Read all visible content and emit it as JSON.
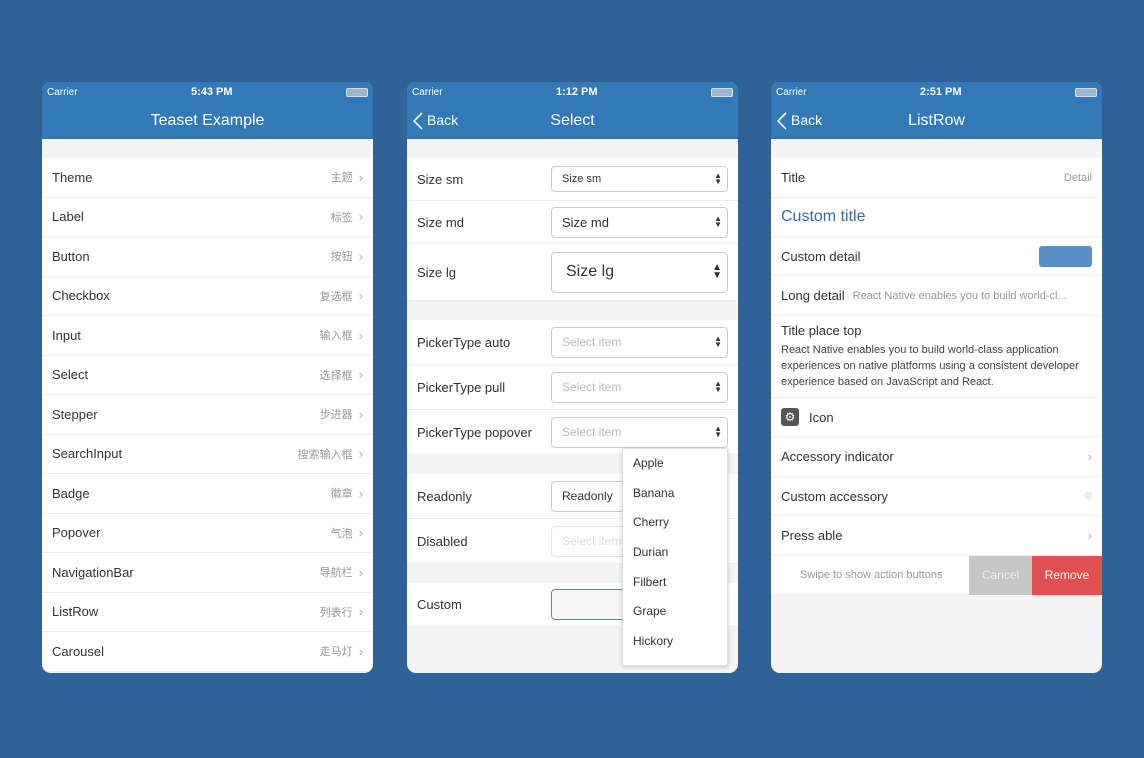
{
  "colors": {
    "background": "#2f6297",
    "navbar": "#3379b8",
    "remove": "#e05050",
    "cancel": "#c7c7c7"
  },
  "phones": [
    {
      "status": {
        "carrier": "Carrier",
        "time": "5:43 PM"
      },
      "title": "Teaset Example",
      "items": [
        {
          "label": "Theme",
          "detail": "主题"
        },
        {
          "label": "Label",
          "detail": "标签"
        },
        {
          "label": "Button",
          "detail": "按钮"
        },
        {
          "label": "Checkbox",
          "detail": "复选框"
        },
        {
          "label": "Input",
          "detail": "输入框"
        },
        {
          "label": "Select",
          "detail": "选择框"
        },
        {
          "label": "Stepper",
          "detail": "步进器"
        },
        {
          "label": "SearchInput",
          "detail": "搜索输入框"
        },
        {
          "label": "Badge",
          "detail": "徽章"
        },
        {
          "label": "Popover",
          "detail": "气泡"
        },
        {
          "label": "NavigationBar",
          "detail": "导航栏"
        },
        {
          "label": "ListRow",
          "detail": "列表行"
        },
        {
          "label": "Carousel",
          "detail": "走马灯"
        }
      ]
    },
    {
      "status": {
        "carrier": "Carrier",
        "time": "1:12 PM"
      },
      "back": "Back",
      "title": "Select",
      "rows": {
        "size_sm": {
          "label": "Size sm",
          "value": "Size sm"
        },
        "size_md": {
          "label": "Size md",
          "value": "Size md"
        },
        "size_lg": {
          "label": "Size lg",
          "value": "Size lg"
        },
        "auto": {
          "label": "PickerType auto",
          "placeholder": "Select item"
        },
        "pull": {
          "label": "PickerType pull",
          "placeholder": "Select item"
        },
        "popover": {
          "label": "PickerType popover",
          "placeholder": "Select item"
        },
        "readonly": {
          "label": "Readonly",
          "value": "Readonly"
        },
        "disabled": {
          "label": "Disabled",
          "placeholder": "Select item"
        },
        "custom": {
          "label": "Custom"
        }
      },
      "popover_items": [
        "Apple",
        "Banana",
        "Cherry",
        "Durian",
        "Filbert",
        "Grape",
        "Hickory"
      ]
    },
    {
      "status": {
        "carrier": "Carrier",
        "time": "2:51 PM"
      },
      "back": "Back",
      "title": "ListRow",
      "rows": {
        "title": {
          "label": "Title",
          "detail": "Detail"
        },
        "custom_title": "Custom title",
        "custom_detail": "Custom detail",
        "long_detail": {
          "label": "Long detail",
          "detail": "React Native enables you to build world-cl..."
        },
        "title_top": {
          "label": "Title place top",
          "detail": "React Native enables you to build world-class application experiences on native platforms using a consistent developer experience based on JavaScript and React."
        },
        "icon": "Icon",
        "accessory_indicator": "Accessory indicator",
        "custom_accessory": "Custom accessory",
        "press_able": "Press able",
        "swipe": {
          "label": "Swipe to show action buttons",
          "cancel": "Cancel",
          "remove": "Remove"
        }
      }
    }
  ]
}
